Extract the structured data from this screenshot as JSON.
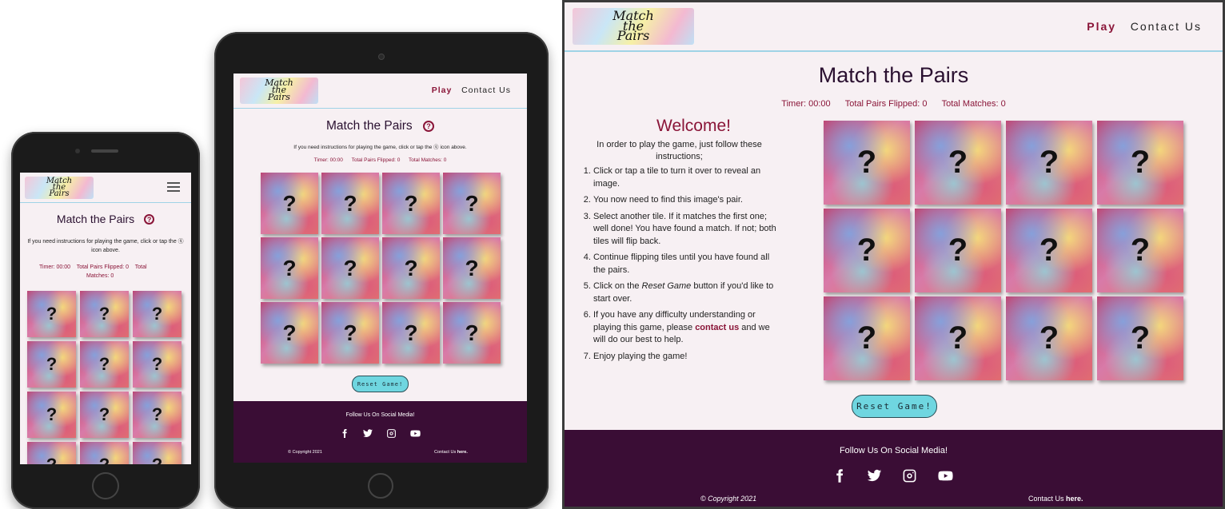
{
  "site": {
    "logo_text": [
      "Match",
      "the",
      "Pairs"
    ],
    "nav": {
      "play": "Play",
      "contact": "Contact Us"
    },
    "title": "Match the Pairs",
    "help_icon": "?",
    "instructions_hint": "If you need instructions for playing the game, click or tap the ⓠ icon above.",
    "stats": {
      "timer": "Timer: 00:00",
      "pairs": "Total Pairs Flipped: 0",
      "matches": "Total Matches: 0",
      "matches_split_a": "Total",
      "matches_split_b": "Matches: 0"
    },
    "tile_mark": "?",
    "reset_label": "Reset Game!",
    "footer": {
      "follow": "Follow Us On Social Media!",
      "copyright": "© Copyright 2021",
      "contact_prefix": "Contact Us ",
      "contact_link": "here."
    },
    "social_icons": [
      "facebook-icon",
      "twitter-icon",
      "instagram-icon",
      "youtube-icon"
    ],
    "hamburger_icon": "menu-icon"
  },
  "desktop": {
    "welcome_title": "Welcome!",
    "welcome_intro": "In order to play the game, just follow these instructions;",
    "steps": [
      {
        "pre": "Click or tap a tile to turn it over to reveal an image.",
        "em": "",
        "link": "",
        "post": ""
      },
      {
        "pre": "You now need to find this image's pair.",
        "em": "",
        "link": "",
        "post": ""
      },
      {
        "pre": "Select another tile. If it matches the first one; well done! You have found a match. If not; both tiles will flip back.",
        "em": "",
        "link": "",
        "post": ""
      },
      {
        "pre": "Continue flipping tiles until you have found all the pairs.",
        "em": "",
        "link": "",
        "post": ""
      },
      {
        "pre": "Click on the ",
        "em": "Reset Game",
        "link": "",
        "post": " button if you'd like to start over."
      },
      {
        "pre": "If you have any difficulty understanding or playing this game, please ",
        "em": "",
        "link": "contact us",
        "post": " and we will do our best to help."
      },
      {
        "pre": "Enjoy playing the game!",
        "em": "",
        "link": "",
        "post": ""
      }
    ]
  },
  "colors": {
    "accent": "#8a1538",
    "footer_bg": "#3a0d35",
    "page_bg": "#f7f0f3",
    "reset_bg": "#6fd6e0",
    "header_rule": "#9fd3e6"
  }
}
